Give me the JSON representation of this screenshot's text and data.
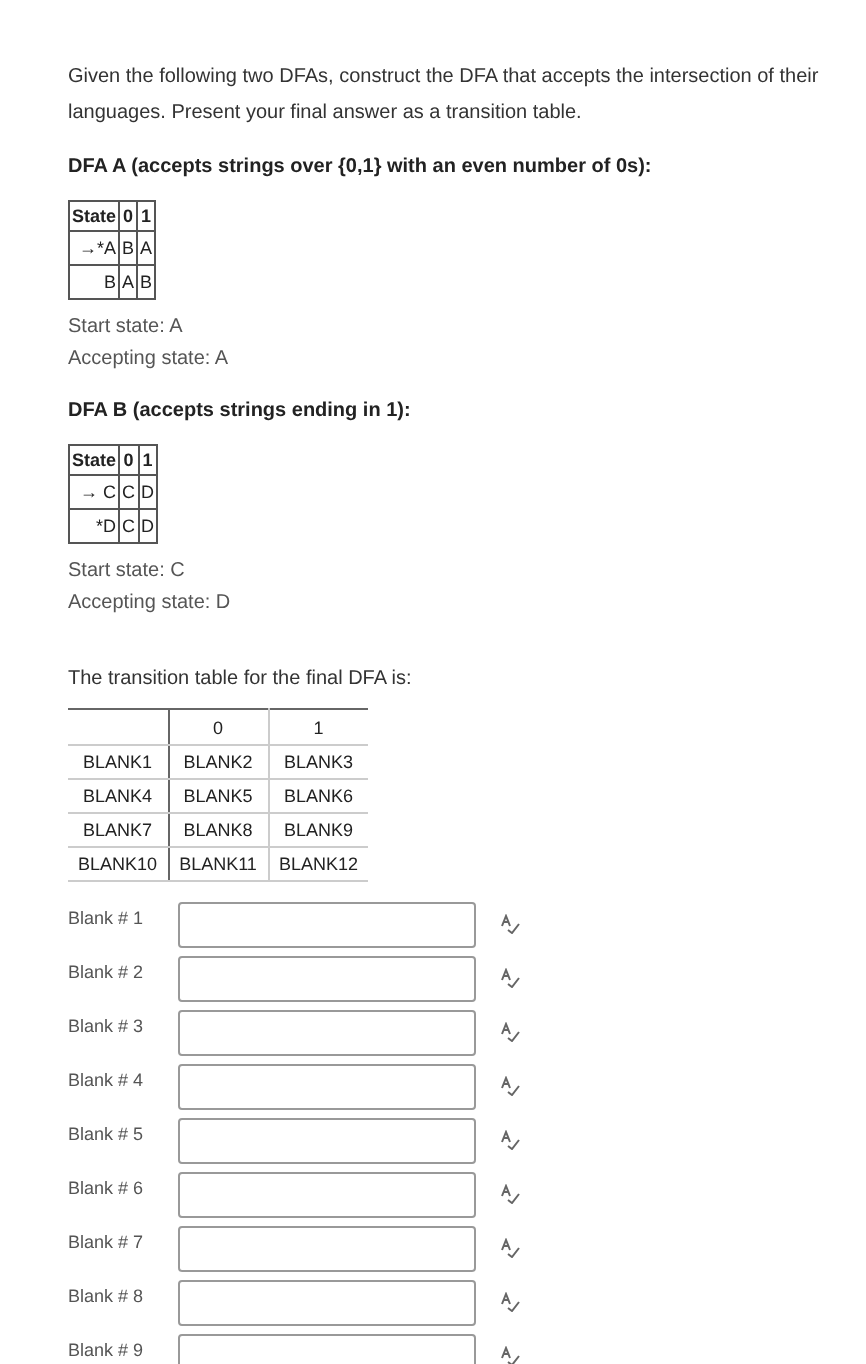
{
  "intro": "Given the following two DFAs, construct the DFA that accepts the intersection of their languages. Present your final answer as a transition table.",
  "dfas": [
    {
      "heading": "DFA A (accepts strings over {0,1} with an even number of 0s):",
      "columns": [
        "State",
        "0",
        "1"
      ],
      "rows": [
        [
          "→*A",
          "B",
          "A"
        ],
        [
          "B",
          "A",
          "B"
        ]
      ],
      "start": "Start state: A",
      "accepting": "Accepting state: A"
    },
    {
      "heading": "DFA B (accepts strings ending in 1):",
      "columns": [
        "State",
        "0",
        "1"
      ],
      "rows": [
        [
          "→ C",
          "C",
          "D"
        ],
        [
          "*D",
          "C",
          "D"
        ]
      ],
      "start": "Start state: C",
      "accepting": "Accepting state: D"
    }
  ],
  "final_table": {
    "caption": "The transition table for the final DFA is:",
    "columns": [
      "",
      "0",
      "1"
    ],
    "rows": [
      [
        "BLANK1",
        "BLANK2",
        "BLANK3"
      ],
      [
        "BLANK4",
        "BLANK5",
        "BLANK6"
      ],
      [
        "BLANK7",
        "BLANK8",
        "BLANK9"
      ],
      [
        "BLANK10",
        "BLANK11",
        "BLANK12"
      ]
    ]
  },
  "blanks": [
    {
      "label": "Blank # 1"
    },
    {
      "label": "Blank # 2"
    },
    {
      "label": "Blank # 3"
    },
    {
      "label": "Blank # 4"
    },
    {
      "label": "Blank # 5"
    },
    {
      "label": "Blank # 6"
    },
    {
      "label": "Blank # 7"
    },
    {
      "label": "Blank # 8"
    },
    {
      "label": "Blank # 9"
    }
  ]
}
